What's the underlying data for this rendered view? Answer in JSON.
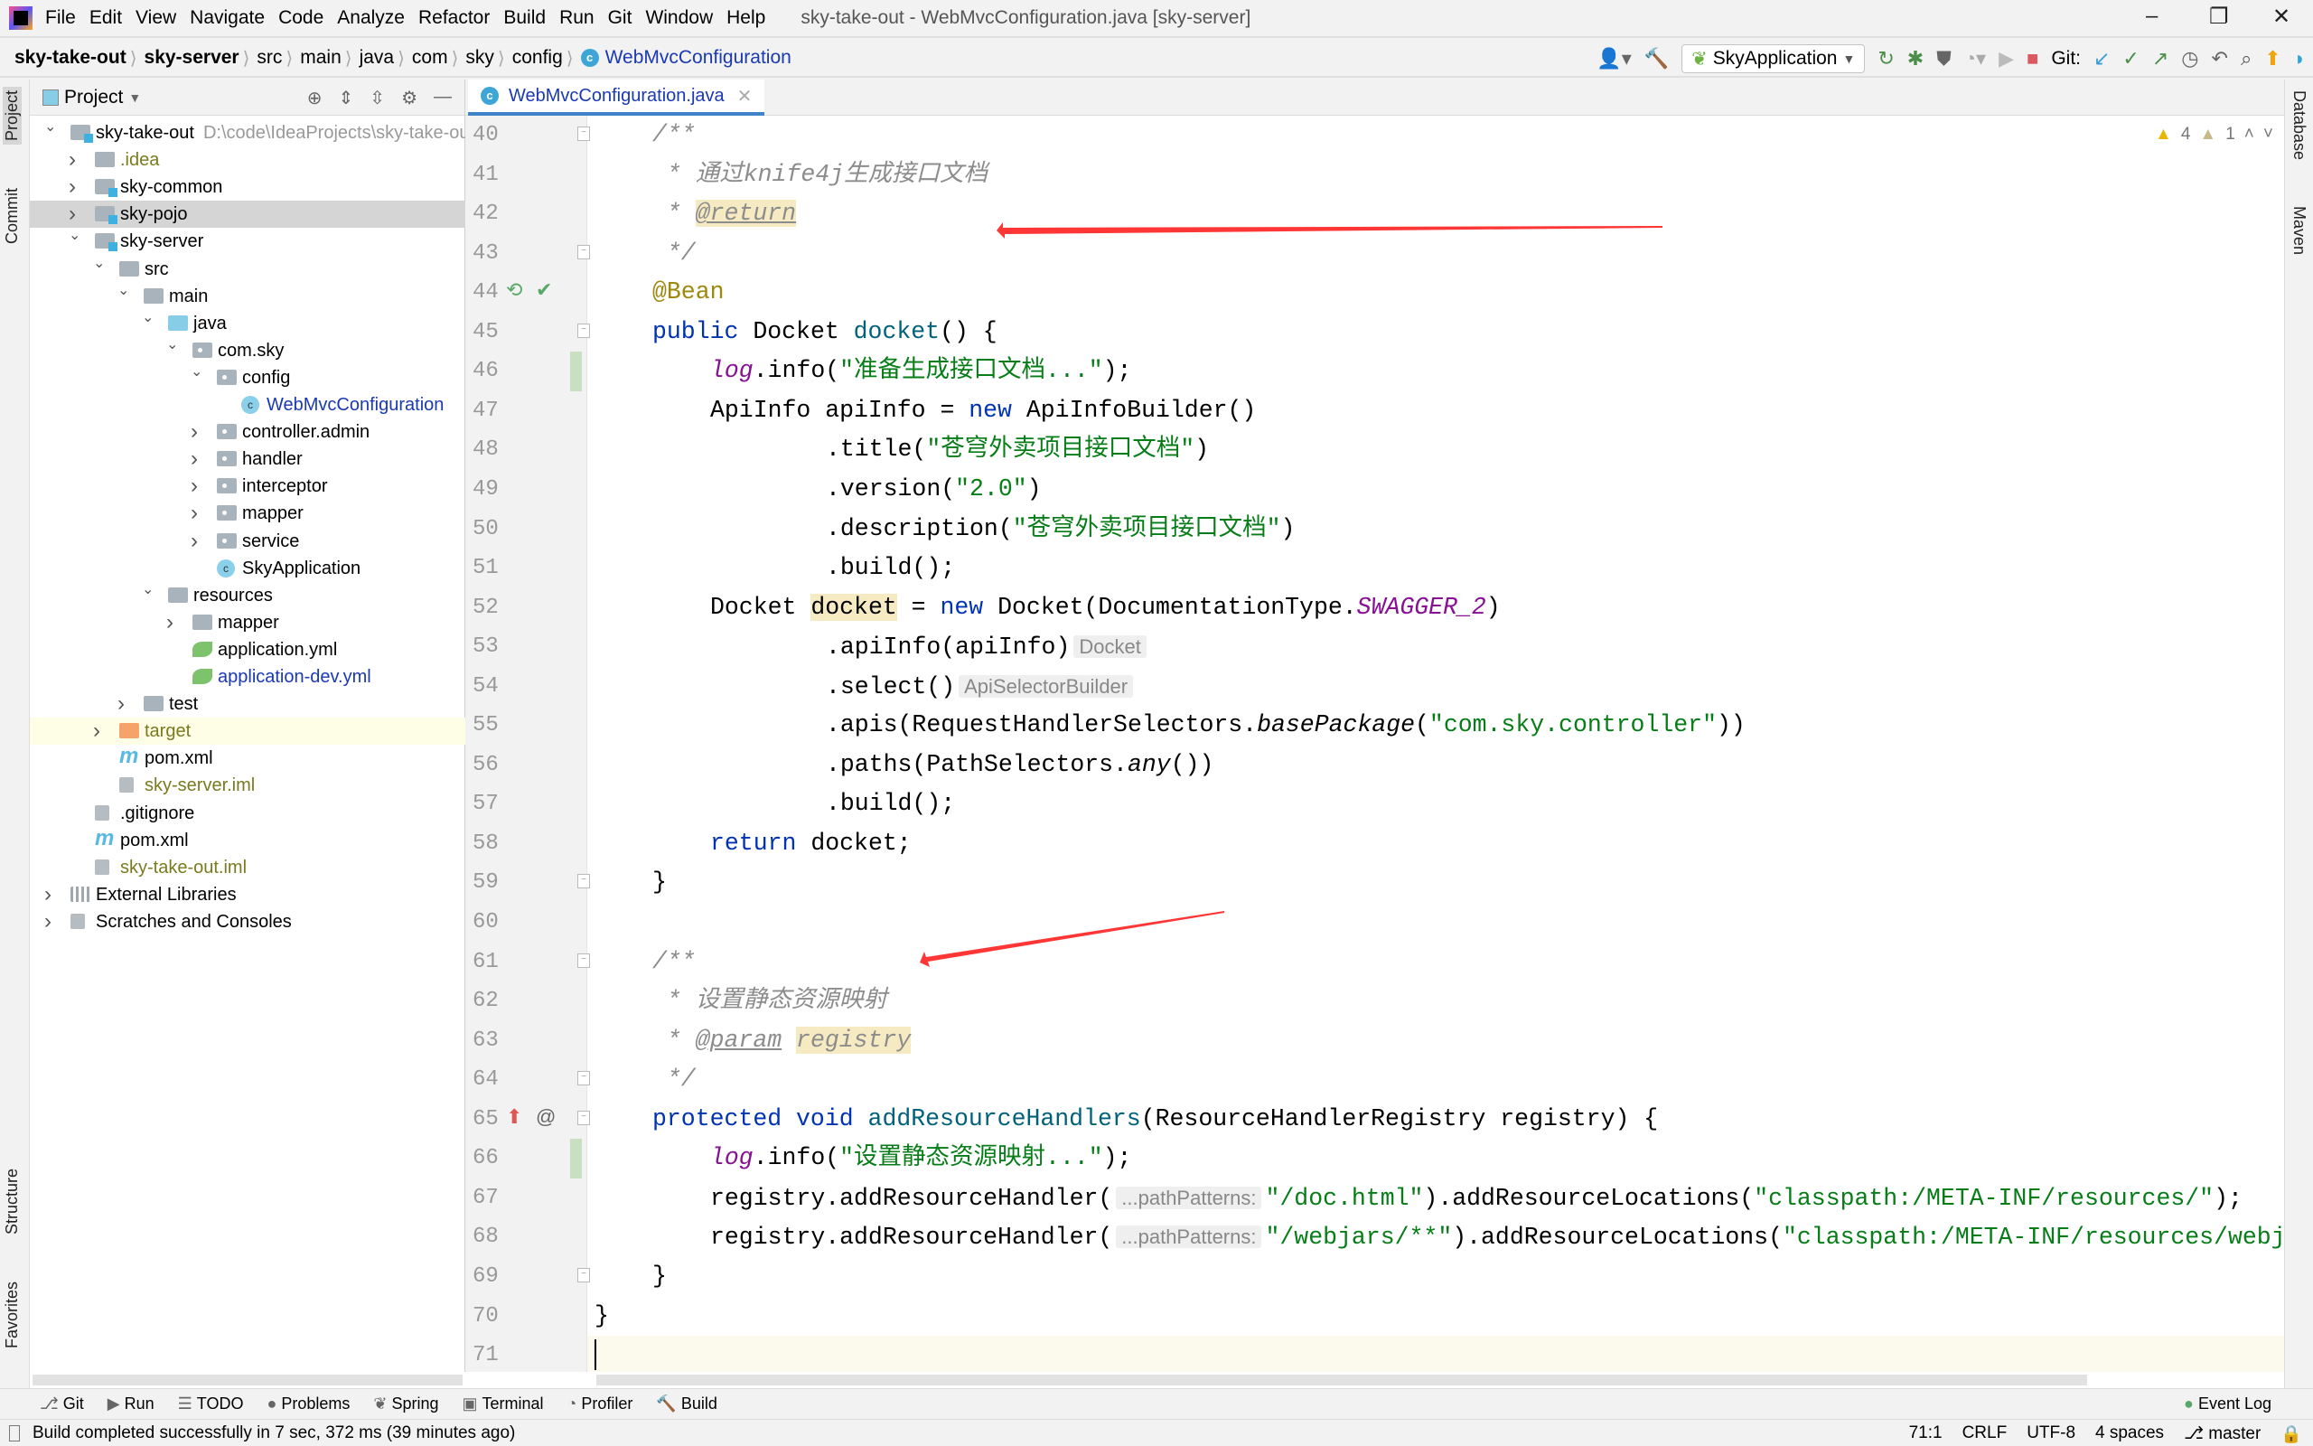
{
  "menu": [
    "File",
    "Edit",
    "View",
    "Navigate",
    "Code",
    "Analyze",
    "Refactor",
    "Build",
    "Run",
    "Git",
    "Window",
    "Help"
  ],
  "window_title": "sky-take-out - WebMvcConfiguration.java [sky-server]",
  "breadcrumb": [
    "sky-take-out",
    "sky-server",
    "src",
    "main",
    "java",
    "com",
    "sky",
    "config",
    "WebMvcConfiguration"
  ],
  "toolbar": {
    "run_config": "SkyApplication",
    "git_label": "Git:"
  },
  "left_tool_tabs": [
    "Project",
    "Commit",
    "Structure",
    "Favorites"
  ],
  "right_tool_tabs": [
    "Database",
    "Maven"
  ],
  "project": {
    "title": "Project",
    "root_path": "D:\\code\\IdeaProjects\\sky-take-out",
    "tree": [
      {
        "label": "sky-take-out",
        "level": 0,
        "state": "open",
        "icon": "module",
        "style": "bold",
        "path": true
      },
      {
        "label": ".idea",
        "level": 1,
        "state": "closed",
        "icon": "folder",
        "style": "olive"
      },
      {
        "label": "sky-common",
        "level": 1,
        "state": "closed",
        "icon": "module",
        "style": "bold"
      },
      {
        "label": "sky-pojo",
        "level": 1,
        "state": "closed",
        "icon": "module",
        "style": "bold",
        "selected": true
      },
      {
        "label": "sky-server",
        "level": 1,
        "state": "open",
        "icon": "module",
        "style": "bold"
      },
      {
        "label": "src",
        "level": 2,
        "state": "open",
        "icon": "folder"
      },
      {
        "label": "main",
        "level": 3,
        "state": "open",
        "icon": "folder"
      },
      {
        "label": "java",
        "level": 4,
        "state": "open",
        "icon": "source-folder"
      },
      {
        "label": "com.sky",
        "level": 5,
        "state": "open",
        "icon": "package"
      },
      {
        "label": "config",
        "level": 6,
        "state": "open",
        "icon": "package"
      },
      {
        "label": "WebMvcConfiguration",
        "level": 7,
        "state": "leaf",
        "icon": "class",
        "style": "blue"
      },
      {
        "label": "controller.admin",
        "level": 6,
        "state": "closed",
        "icon": "package"
      },
      {
        "label": "handler",
        "level": 6,
        "state": "closed",
        "icon": "package"
      },
      {
        "label": "interceptor",
        "level": 6,
        "state": "closed",
        "icon": "package"
      },
      {
        "label": "mapper",
        "level": 6,
        "state": "closed",
        "icon": "package"
      },
      {
        "label": "service",
        "level": 6,
        "state": "closed",
        "icon": "package"
      },
      {
        "label": "SkyApplication",
        "level": 6,
        "state": "leaf",
        "icon": "spring-class"
      },
      {
        "label": "resources",
        "level": 4,
        "state": "open",
        "icon": "resources-folder"
      },
      {
        "label": "mapper",
        "level": 5,
        "state": "closed",
        "icon": "folder"
      },
      {
        "label": "application.yml",
        "level": 5,
        "state": "leaf",
        "icon": "spring-yml"
      },
      {
        "label": "application-dev.yml",
        "level": 5,
        "state": "leaf",
        "icon": "spring-yml",
        "style": "blue"
      },
      {
        "label": "test",
        "level": 3,
        "state": "closed",
        "icon": "folder"
      },
      {
        "label": "target",
        "level": 2,
        "state": "closed",
        "icon": "excluded-folder",
        "style": "olive",
        "highlight": true
      },
      {
        "label": "pom.xml",
        "level": 2,
        "state": "leaf",
        "icon": "maven"
      },
      {
        "label": "sky-server.iml",
        "level": 2,
        "state": "leaf",
        "icon": "iml",
        "style": "olive"
      },
      {
        "label": ".gitignore",
        "level": 1,
        "state": "leaf",
        "icon": "ignore-file"
      },
      {
        "label": "pom.xml",
        "level": 1,
        "state": "leaf",
        "icon": "maven"
      },
      {
        "label": "sky-take-out.iml",
        "level": 1,
        "state": "leaf",
        "icon": "iml",
        "style": "olive"
      },
      {
        "label": "External Libraries",
        "level": 0,
        "state": "closed",
        "icon": "libraries"
      },
      {
        "label": "Scratches and Consoles",
        "level": 0,
        "state": "closed",
        "icon": "scratches"
      }
    ]
  },
  "editor": {
    "tab_label": "WebMvcConfiguration.java",
    "inspections": {
      "warnings": "4",
      "weak_warnings": "1"
    },
    "current_line": 71,
    "lines": [
      {
        "n": 40,
        "i": 1,
        "t": [
          [
            "cm",
            "/**"
          ]
        ]
      },
      {
        "n": 41,
        "i": 1,
        "t": [
          [
            "cm",
            " * 通过knife4j生成接口文档"
          ]
        ]
      },
      {
        "n": 42,
        "i": 1,
        "t": [
          [
            "cm",
            " * "
          ],
          [
            "tag hlw",
            "@return"
          ]
        ]
      },
      {
        "n": 43,
        "i": 1,
        "t": [
          [
            "cm",
            " */"
          ]
        ]
      },
      {
        "n": 44,
        "i": 1,
        "t": [
          [
            "ann",
            "@Bean"
          ]
        ]
      },
      {
        "n": 45,
        "i": 1,
        "t": [
          [
            "kw",
            "public "
          ],
          [
            "",
            "Docket "
          ],
          [
            "fn",
            "docket"
          ],
          [
            "",
            "() {"
          ]
        ]
      },
      {
        "n": 46,
        "i": 2,
        "t": [
          [
            "st",
            "log"
          ],
          [
            "",
            ".info("
          ],
          [
            "str",
            "\"准备生成接口文档...\""
          ],
          [
            "",
            ");"
          ]
        ]
      },
      {
        "n": 47,
        "i": 2,
        "t": [
          [
            "",
            "ApiInfo apiInfo = "
          ],
          [
            "kw",
            "new "
          ],
          [
            "",
            "ApiInfoBuilder()"
          ]
        ]
      },
      {
        "n": 48,
        "i": 4,
        "t": [
          [
            "",
            ".title("
          ],
          [
            "str",
            "\"苍穹外卖项目接口文档\""
          ],
          [
            "",
            ")"
          ]
        ]
      },
      {
        "n": 49,
        "i": 4,
        "t": [
          [
            "",
            ".version("
          ],
          [
            "str",
            "\"2.0\""
          ],
          [
            "",
            ")"
          ]
        ]
      },
      {
        "n": 50,
        "i": 4,
        "t": [
          [
            "",
            ".description("
          ],
          [
            "str",
            "\"苍穹外卖项目接口文档\""
          ],
          [
            "",
            ")"
          ]
        ]
      },
      {
        "n": 51,
        "i": 4,
        "t": [
          [
            "",
            ".build();"
          ]
        ]
      },
      {
        "n": 52,
        "i": 2,
        "t": [
          [
            "",
            "Docket "
          ],
          [
            "hlw",
            "docket"
          ],
          [
            "",
            " = "
          ],
          [
            "kw",
            "new "
          ],
          [
            "",
            "Docket(DocumentationType."
          ],
          [
            "st",
            "SWAGGER_2"
          ],
          [
            "",
            ")"
          ]
        ]
      },
      {
        "n": 53,
        "i": 4,
        "t": [
          [
            "",
            ".apiInfo(apiInfo)"
          ],
          [
            "hint",
            "Docket"
          ]
        ]
      },
      {
        "n": 54,
        "i": 4,
        "t": [
          [
            "",
            ".select()"
          ],
          [
            "hint",
            "ApiSelectorBuilder"
          ]
        ]
      },
      {
        "n": 55,
        "i": 4,
        "t": [
          [
            "",
            ".apis(RequestHandlerSelectors."
          ],
          [
            "it",
            "basePackage"
          ],
          [
            "",
            "("
          ],
          [
            "str",
            "\"com.sky.controller\""
          ],
          [
            "",
            "))"
          ]
        ]
      },
      {
        "n": 56,
        "i": 4,
        "t": [
          [
            "",
            ".paths(PathSelectors."
          ],
          [
            "it",
            "any"
          ],
          [
            "",
            "())"
          ]
        ]
      },
      {
        "n": 57,
        "i": 4,
        "t": [
          [
            "",
            ".build();"
          ]
        ]
      },
      {
        "n": 58,
        "i": 2,
        "t": [
          [
            "kw",
            "return "
          ],
          [
            "",
            "docket;"
          ]
        ]
      },
      {
        "n": 59,
        "i": 1,
        "t": [
          [
            "",
            "}"
          ]
        ]
      },
      {
        "n": 60,
        "i": 0,
        "t": []
      },
      {
        "n": 61,
        "i": 1,
        "t": [
          [
            "cm",
            "/**"
          ]
        ]
      },
      {
        "n": 62,
        "i": 1,
        "t": [
          [
            "cm",
            " * 设置静态资源映射"
          ]
        ]
      },
      {
        "n": 63,
        "i": 1,
        "t": [
          [
            "cm",
            " * "
          ],
          [
            "tag",
            "@param"
          ],
          [
            "cm",
            " "
          ],
          [
            "cm hlw",
            "registry"
          ]
        ]
      },
      {
        "n": 64,
        "i": 1,
        "t": [
          [
            "cm",
            " */"
          ]
        ]
      },
      {
        "n": 65,
        "i": 1,
        "t": [
          [
            "kw",
            "protected void "
          ],
          [
            "fn",
            "addResourceHandlers"
          ],
          [
            "",
            "(ResourceHandlerRegistry registry) {"
          ]
        ]
      },
      {
        "n": 66,
        "i": 2,
        "t": [
          [
            "st",
            "log"
          ],
          [
            "",
            ".info("
          ],
          [
            "str",
            "\"设置静态资源映射...\""
          ],
          [
            "",
            ");"
          ]
        ]
      },
      {
        "n": 67,
        "i": 2,
        "t": [
          [
            "",
            "registry.addResourceHandler("
          ],
          [
            "hint",
            "...pathPatterns:"
          ],
          [
            "str",
            "\"/doc.html\""
          ],
          [
            "",
            ").addResourceLocations("
          ],
          [
            "str",
            "\"classpath:/META-INF/resources/\""
          ],
          [
            "",
            ");"
          ]
        ]
      },
      {
        "n": 68,
        "i": 2,
        "t": [
          [
            "",
            "registry.addResourceHandler("
          ],
          [
            "hint",
            "...pathPatterns:"
          ],
          [
            "str",
            "\"/webjars/**\""
          ],
          [
            "",
            ").addResourceLocations("
          ],
          [
            "str",
            "\"classpath:/META-INF/resources/webjars/\""
          ],
          [
            "",
            ");"
          ]
        ]
      },
      {
        "n": 69,
        "i": 1,
        "t": [
          [
            "",
            "}"
          ]
        ]
      },
      {
        "n": 70,
        "i": 0,
        "t": [
          [
            "",
            "}"
          ]
        ]
      },
      {
        "n": 71,
        "i": 0,
        "t": []
      }
    ]
  },
  "bottom_tools": [
    "Git",
    "Run",
    "TODO",
    "Problems",
    "Spring",
    "Terminal",
    "Profiler",
    "Build"
  ],
  "event_log": "Event Log",
  "status": {
    "message": "Build completed successfully in 7 sec, 372 ms (39 minutes ago)",
    "position": "71:1",
    "line_separator": "CRLF",
    "encoding": "UTF-8",
    "indent": "4 spaces",
    "branch": "master"
  },
  "annotation_color": "#ff2020"
}
